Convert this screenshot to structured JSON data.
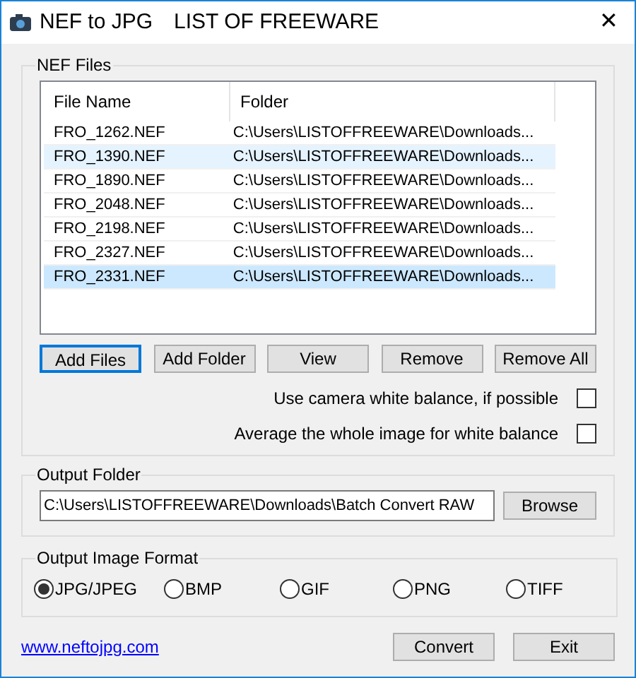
{
  "window": {
    "title": "NEF to JPG",
    "subtitle": "LIST OF FREEWARE",
    "close": "✕"
  },
  "nef_files": {
    "label": "NEF Files",
    "table": {
      "columns": [
        "File Name",
        "Folder"
      ],
      "rows": [
        {
          "cells": [
            "FRO_1262.NEF",
            "C:\\Users\\LISTOFFREEWARE\\Downloads..."
          ],
          "selected": false,
          "hot": false
        },
        {
          "cells": [
            "FRO_1390.NEF",
            "C:\\Users\\LISTOFFREEWARE\\Downloads..."
          ],
          "selected": false,
          "hot": true
        },
        {
          "cells": [
            "FRO_1890.NEF",
            "C:\\Users\\LISTOFFREEWARE\\Downloads..."
          ],
          "selected": false,
          "hot": false
        },
        {
          "cells": [
            "FRO_2048.NEF",
            "C:\\Users\\LISTOFFREEWARE\\Downloads..."
          ],
          "selected": false,
          "hot": false
        },
        {
          "cells": [
            "FRO_2198.NEF",
            "C:\\Users\\LISTOFFREEWARE\\Downloads..."
          ],
          "selected": false,
          "hot": false
        },
        {
          "cells": [
            "FRO_2327.NEF",
            "C:\\Users\\LISTOFFREEWARE\\Downloads..."
          ],
          "selected": false,
          "hot": false
        },
        {
          "cells": [
            "FRO_2331.NEF",
            "C:\\Users\\LISTOFFREEWARE\\Downloads..."
          ],
          "selected": true,
          "hot": false
        }
      ]
    },
    "buttons": [
      {
        "label": "Add Files",
        "focused": true
      },
      {
        "label": "Add Folder",
        "focused": false
      },
      {
        "label": "View",
        "focused": false
      },
      {
        "label": "Remove",
        "focused": false
      },
      {
        "label": "Remove All",
        "focused": false
      }
    ],
    "options": [
      {
        "label": "Use camera white balance, if possible",
        "checked": false
      },
      {
        "label": "Average the whole image for white balance",
        "checked": false
      }
    ]
  },
  "output_folder": {
    "label": "Output Folder",
    "value": "C:\\Users\\LISTOFFREEWARE\\Downloads\\Batch Convert RAW",
    "button": "Browse"
  },
  "output_format": {
    "label": "Output Image Format",
    "options": [
      {
        "label": "JPG/JPEG",
        "selected": true
      },
      {
        "label": "BMP",
        "selected": false
      },
      {
        "label": "GIF",
        "selected": false
      },
      {
        "label": "PNG",
        "selected": false
      },
      {
        "label": "TIFF",
        "selected": false
      }
    ]
  },
  "footer": {
    "link": "www.neftojpg.com",
    "buttons": [
      "Convert",
      "Exit"
    ]
  }
}
